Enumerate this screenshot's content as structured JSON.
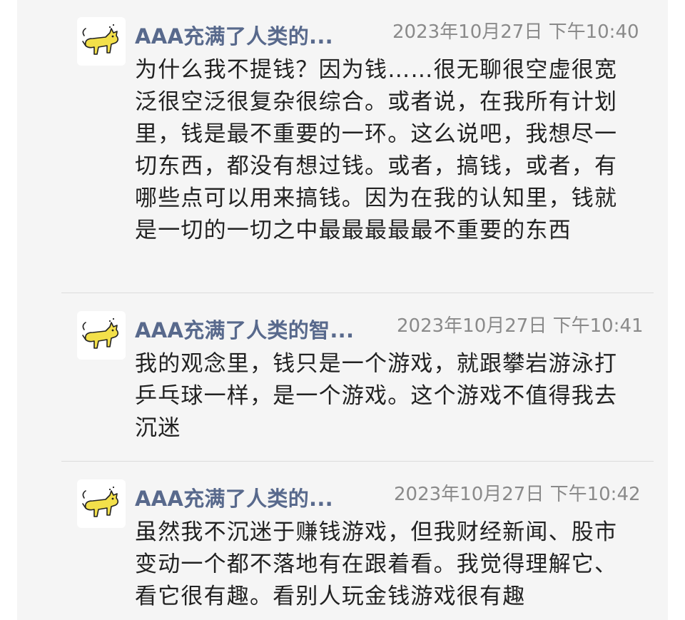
{
  "messages": [
    {
      "sender": "AAA充满了人类的...",
      "time": "2023年10月27日 下午10:40",
      "text": "为什么我不提钱？因为钱……很无聊很空虚很宽泛很空泛很复杂很综合。或者说，在我所有计划里，钱是最不重要的一环。这么说吧，我想尽一切东西，都没有想过钱。或者，搞钱，或者，有哪些点可以用来搞钱。因为在我的认知里，钱就是一切的一切之中最最最最最不重要的东西",
      "avatar_icon": "yellow-cat-icon"
    },
    {
      "sender": "AAA充满了人类的智...",
      "time": "2023年10月27日 下午10:41",
      "text": "我的观念里，钱只是一个游戏，就跟攀岩游泳打乒乓球一样，是一个游戏。这个游戏不值得我去沉迷",
      "avatar_icon": "yellow-cat-icon"
    },
    {
      "sender": "AAA充满了人类的...",
      "time": "2023年10月27日 下午10:42",
      "text": "虽然我不沉迷于赚钱游戏，但我财经新闻、股市变动一个都不落地有在跟着看。我觉得理解它、看它很有趣。看别人玩金钱游戏很有趣",
      "avatar_icon": "yellow-cat-icon"
    }
  ],
  "colors": {
    "sender": "#58698c",
    "time": "#8a8a8a",
    "text": "#222222",
    "panel": "#f5f5f5",
    "cat": "#f3e04a"
  }
}
